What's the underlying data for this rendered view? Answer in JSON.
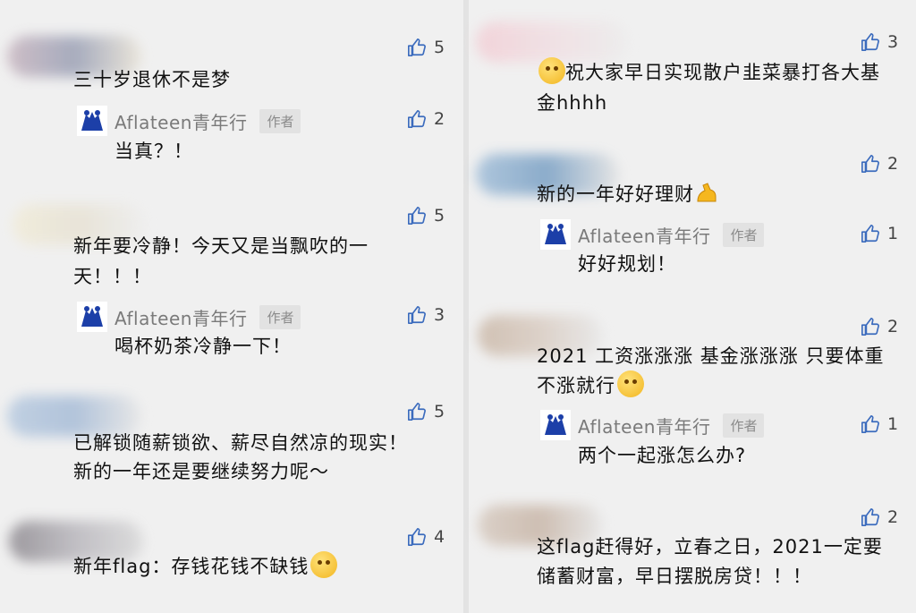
{
  "left": {
    "comments": [
      {
        "text": "三十岁退休不是梦",
        "likes": "5",
        "reply": {
          "name": "Aflateen青年行",
          "badge": "作者",
          "text": "当真？！",
          "likes": "2"
        }
      },
      {
        "text_line1": "新年要冷静！今天又是当飘吹的一",
        "text_line2": "天！！！",
        "likes": "5",
        "reply": {
          "name": "Aflateen青年行",
          "badge": "作者",
          "text": "喝杯奶茶冷静一下！",
          "likes": "3"
        }
      },
      {
        "text_line1": "已解锁随薪锁欲、薪尽自然凉的现实！",
        "text_line2": "新的一年还是要继续努力呢～",
        "likes": "5"
      },
      {
        "text": "新年flag：存钱花钱不缺钱",
        "likes": "4",
        "emoji": "thinking-face-icon"
      }
    ]
  },
  "right": {
    "comments": [
      {
        "text_line1": "祝大家早日实现散户韭菜暴打各大基",
        "text_line2": "金hhhh",
        "likes": "3",
        "emoji": "winking-face-icon"
      },
      {
        "text": "新的一年好好理财",
        "likes": "2",
        "emoji": "flexed-biceps-icon",
        "reply": {
          "name": "Aflateen青年行",
          "badge": "作者",
          "text": "好好规划！",
          "likes": "1"
        }
      },
      {
        "text_line1": "2021 工资涨涨涨 基金涨涨涨 只要体重",
        "text_line2": "不涨就行",
        "likes": "2",
        "emoji": "thinking-face-icon",
        "reply": {
          "name": "Aflateen青年行",
          "badge": "作者",
          "text": "两个一起涨怎么办?",
          "likes": "1"
        }
      },
      {
        "text_line1": "这flag赶得好，立春之日，2021一定要",
        "text_line2": "储蓄财富，早日摆脱房贷！！！",
        "likes": "2"
      }
    ]
  }
}
